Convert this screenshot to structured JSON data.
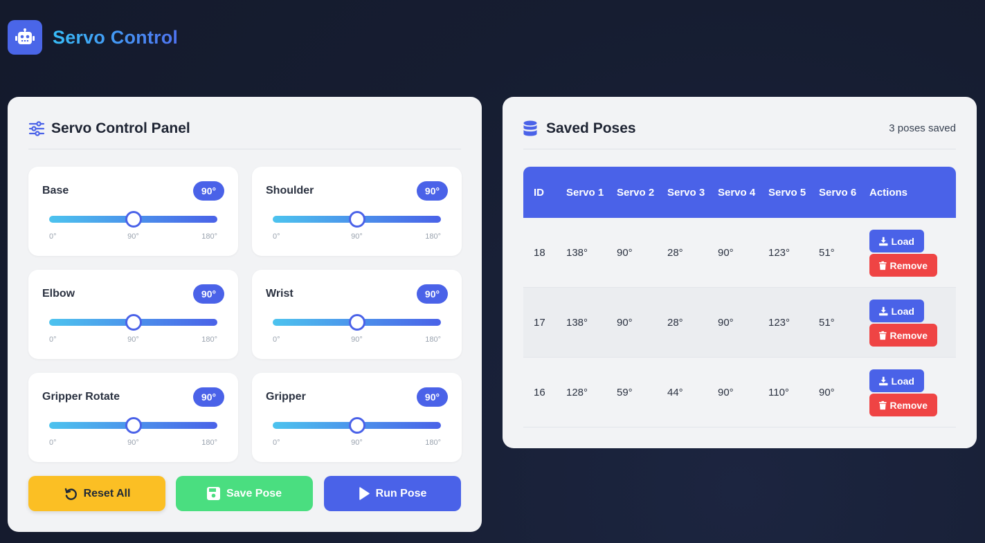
{
  "app": {
    "title": "Servo Control",
    "logo_icon": "robot-icon"
  },
  "control_panel": {
    "title": "Servo Control Panel",
    "icon": "sliders-icon",
    "servos": [
      {
        "name": "Base",
        "value_label": "90°",
        "value": 90,
        "min_label": "0°",
        "mid_label": "90°",
        "max_label": "180°"
      },
      {
        "name": "Shoulder",
        "value_label": "90°",
        "value": 90,
        "min_label": "0°",
        "mid_label": "90°",
        "max_label": "180°"
      },
      {
        "name": "Elbow",
        "value_label": "90°",
        "value": 90,
        "min_label": "0°",
        "mid_label": "90°",
        "max_label": "180°"
      },
      {
        "name": "Wrist",
        "value_label": "90°",
        "value": 90,
        "min_label": "0°",
        "mid_label": "90°",
        "max_label": "180°"
      },
      {
        "name": "Gripper Rotate",
        "value_label": "90°",
        "value": 90,
        "min_label": "0°",
        "mid_label": "90°",
        "max_label": "180°"
      },
      {
        "name": "Gripper",
        "value_label": "90°",
        "value": 90,
        "min_label": "0°",
        "mid_label": "90°",
        "max_label": "180°"
      }
    ],
    "actions": {
      "reset_label": "Reset All",
      "save_label": "Save Pose",
      "run_label": "Run Pose"
    }
  },
  "saved_poses": {
    "title": "Saved Poses",
    "icon": "database-icon",
    "count_label": "3 poses saved",
    "headers": [
      "ID",
      "Servo 1",
      "Servo 2",
      "Servo 3",
      "Servo 4",
      "Servo 5",
      "Servo 6",
      "Actions"
    ],
    "rows": [
      {
        "id": "18",
        "values": [
          "138°",
          "90°",
          "28°",
          "90°",
          "123°",
          "51°"
        ]
      },
      {
        "id": "17",
        "values": [
          "138°",
          "90°",
          "28°",
          "90°",
          "123°",
          "51°"
        ]
      },
      {
        "id": "16",
        "values": [
          "128°",
          "59°",
          "44°",
          "90°",
          "110°",
          "90°"
        ]
      }
    ],
    "load_label": "Load",
    "remove_label": "Remove"
  },
  "colors": {
    "background": "#161d31",
    "card": "#f2f3f5",
    "accent": "#4a62e8",
    "reset": "#fbbf24",
    "save": "#4ade80",
    "remove": "#ef4444"
  }
}
